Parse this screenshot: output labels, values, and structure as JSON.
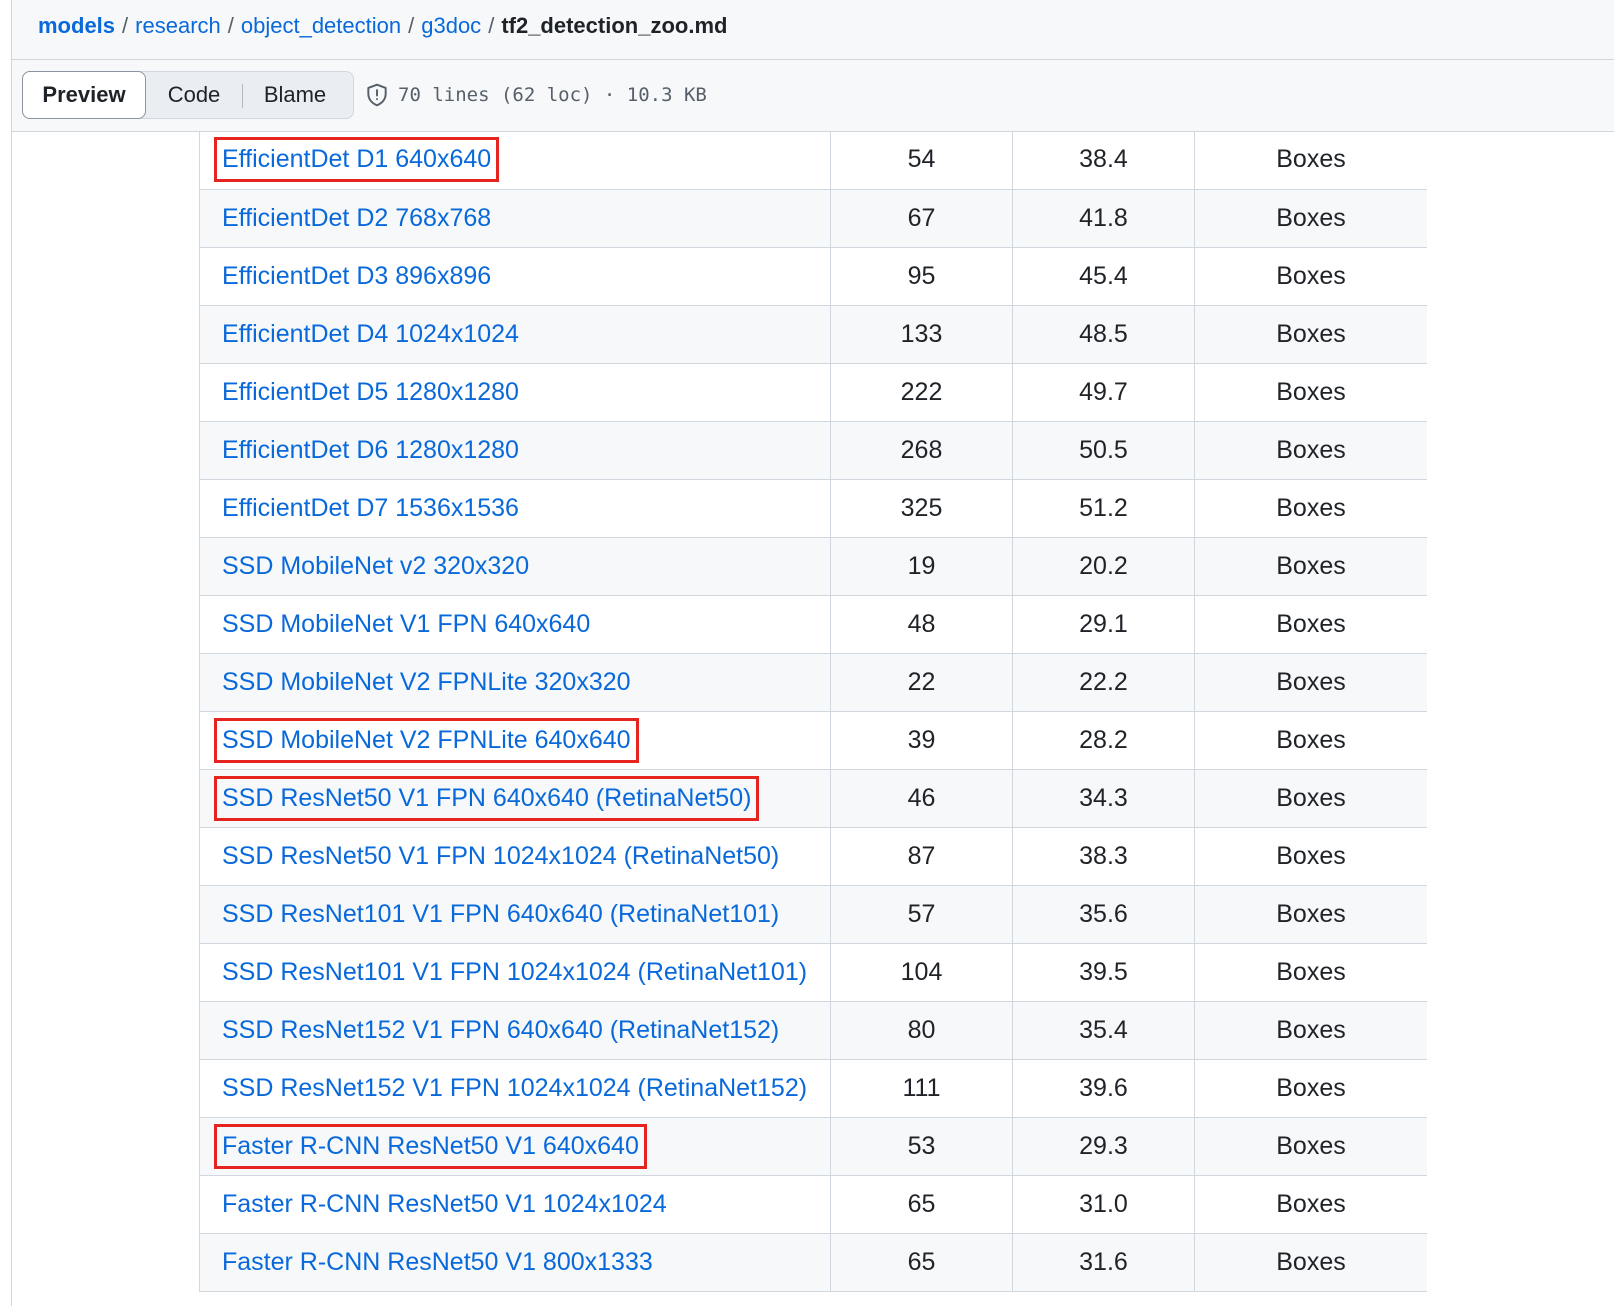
{
  "breadcrumb": {
    "items": [
      "models",
      "research",
      "object_detection",
      "g3doc"
    ],
    "separator": "/",
    "file": "tf2_detection_zoo.md"
  },
  "toolbar": {
    "preview_label": "Preview",
    "code_label": "Code",
    "blame_label": "Blame",
    "file_info": "70 lines (62 loc) · 10.3 KB",
    "info_icon": "shield-icon"
  },
  "colors": {
    "link": "#0969da",
    "highlight_box": "#e5231f",
    "stripe": "#f6f8fa",
    "border": "#d0d7de"
  },
  "table": {
    "rows": [
      {
        "name": "EfficientDet D1 640x640",
        "speed": "54",
        "map": "38.4",
        "outputs": "Boxes",
        "highlighted": true
      },
      {
        "name": "EfficientDet D2 768x768",
        "speed": "67",
        "map": "41.8",
        "outputs": "Boxes",
        "highlighted": false
      },
      {
        "name": "EfficientDet D3 896x896",
        "speed": "95",
        "map": "45.4",
        "outputs": "Boxes",
        "highlighted": false
      },
      {
        "name": "EfficientDet D4 1024x1024",
        "speed": "133",
        "map": "48.5",
        "outputs": "Boxes",
        "highlighted": false
      },
      {
        "name": "EfficientDet D5 1280x1280",
        "speed": "222",
        "map": "49.7",
        "outputs": "Boxes",
        "highlighted": false
      },
      {
        "name": "EfficientDet D6 1280x1280",
        "speed": "268",
        "map": "50.5",
        "outputs": "Boxes",
        "highlighted": false
      },
      {
        "name": "EfficientDet D7 1536x1536",
        "speed": "325",
        "map": "51.2",
        "outputs": "Boxes",
        "highlighted": false
      },
      {
        "name": "SSD MobileNet v2 320x320",
        "speed": "19",
        "map": "20.2",
        "outputs": "Boxes",
        "highlighted": false
      },
      {
        "name": "SSD MobileNet V1 FPN 640x640",
        "speed": "48",
        "map": "29.1",
        "outputs": "Boxes",
        "highlighted": false
      },
      {
        "name": "SSD MobileNet V2 FPNLite 320x320",
        "speed": "22",
        "map": "22.2",
        "outputs": "Boxes",
        "highlighted": false
      },
      {
        "name": "SSD MobileNet V2 FPNLite 640x640",
        "speed": "39",
        "map": "28.2",
        "outputs": "Boxes",
        "highlighted": true
      },
      {
        "name": "SSD ResNet50 V1 FPN 640x640 (RetinaNet50)",
        "speed": "46",
        "map": "34.3",
        "outputs": "Boxes",
        "highlighted": true
      },
      {
        "name": "SSD ResNet50 V1 FPN 1024x1024 (RetinaNet50)",
        "speed": "87",
        "map": "38.3",
        "outputs": "Boxes",
        "highlighted": false
      },
      {
        "name": "SSD ResNet101 V1 FPN 640x640 (RetinaNet101)",
        "speed": "57",
        "map": "35.6",
        "outputs": "Boxes",
        "highlighted": false
      },
      {
        "name": "SSD ResNet101 V1 FPN 1024x1024 (RetinaNet101)",
        "speed": "104",
        "map": "39.5",
        "outputs": "Boxes",
        "highlighted": false
      },
      {
        "name": "SSD ResNet152 V1 FPN 640x640 (RetinaNet152)",
        "speed": "80",
        "map": "35.4",
        "outputs": "Boxes",
        "highlighted": false
      },
      {
        "name": "SSD ResNet152 V1 FPN 1024x1024 (RetinaNet152)",
        "speed": "111",
        "map": "39.6",
        "outputs": "Boxes",
        "highlighted": false
      },
      {
        "name": "Faster R-CNN ResNet50 V1 640x640",
        "speed": "53",
        "map": "29.3",
        "outputs": "Boxes",
        "highlighted": true
      },
      {
        "name": "Faster R-CNN ResNet50 V1 1024x1024",
        "speed": "65",
        "map": "31.0",
        "outputs": "Boxes",
        "highlighted": false
      },
      {
        "name": "Faster R-CNN ResNet50 V1 800x1333",
        "speed": "65",
        "map": "31.6",
        "outputs": "Boxes",
        "highlighted": false
      }
    ]
  }
}
